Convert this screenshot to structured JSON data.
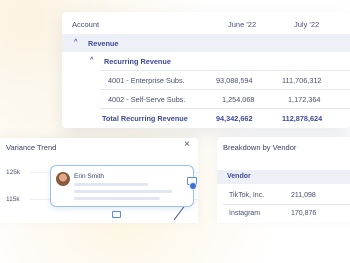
{
  "table": {
    "columns": [
      "Account",
      "June '22",
      "July '22"
    ],
    "group_label": "Revenue",
    "subgroup_label": "Recurring Revenue",
    "rows": [
      {
        "account": "4001 - Enterprise Subs.",
        "june": "93,088,594",
        "july": "111,706,312"
      },
      {
        "account": "4002 - Self-Serve Subs.",
        "june": "1,254,068",
        "july": "1,172,364"
      }
    ],
    "total": {
      "account": "Total Recurring Revenue",
      "june": "94,342,662",
      "july": "112,878,624"
    }
  },
  "trend": {
    "title": "Variance Trend",
    "y_labels": [
      "125k",
      "115k"
    ],
    "comment_author": "Erin Smith"
  },
  "vendor": {
    "title": "Breakdown by Vendor",
    "column": "Vendor",
    "rows": [
      {
        "name": "TikTok, Inc.",
        "value": "211,098"
      },
      {
        "name": "Instagram",
        "value": "170,876"
      }
    ]
  },
  "icons": {
    "close": "close-icon",
    "chevron": "chevron-up-icon",
    "comment": "comment-icon"
  },
  "colors": {
    "accent": "#3f4a9c",
    "highlight": "#eef0f7",
    "pin": "#3e6fd6"
  }
}
